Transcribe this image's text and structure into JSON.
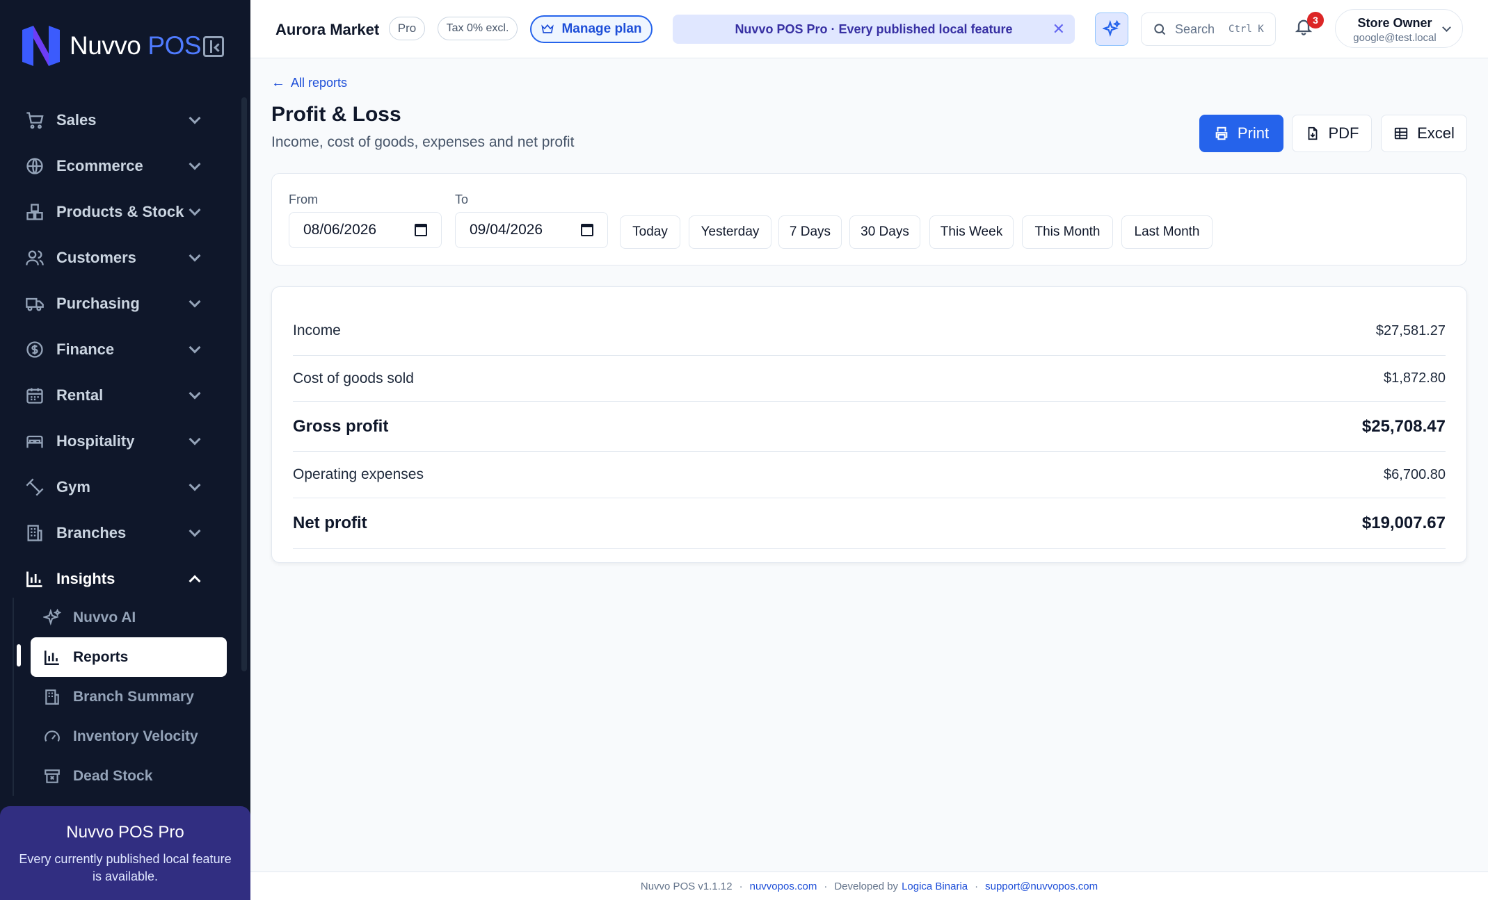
{
  "app": {
    "brand_name": "Nuvvo",
    "brand_suffix": "POS",
    "brand_color": "#4f7bff"
  },
  "sidebar": {
    "nav": [
      {
        "label": "Sales",
        "icon": "cart-icon"
      },
      {
        "label": "Ecommerce",
        "icon": "globe-icon"
      },
      {
        "label": "Products & Stock",
        "icon": "boxes-icon"
      },
      {
        "label": "Customers",
        "icon": "users-icon"
      },
      {
        "label": "Purchasing",
        "icon": "truck-icon"
      },
      {
        "label": "Finance",
        "icon": "dollar-circle-icon"
      },
      {
        "label": "Rental",
        "icon": "calendar-icon"
      },
      {
        "label": "Hospitality",
        "icon": "bed-icon"
      },
      {
        "label": "Gym",
        "icon": "dumbbell-icon"
      },
      {
        "label": "Branches",
        "icon": "building-icon"
      },
      {
        "label": "Insights",
        "icon": "bar-chart-icon",
        "expanded": true
      }
    ],
    "insights_sub": [
      {
        "label": "Nuvvo AI",
        "icon": "sparkles-icon"
      },
      {
        "label": "Reports",
        "icon": "bar-chart-icon",
        "active": true
      },
      {
        "label": "Branch Summary",
        "icon": "building-icon"
      },
      {
        "label": "Inventory Velocity",
        "icon": "gauge-icon"
      },
      {
        "label": "Dead Stock",
        "icon": "archive-x-icon"
      }
    ],
    "promo": {
      "title": "Nuvvo POS Pro",
      "desc": "Every currently published local feature is available."
    }
  },
  "topbar": {
    "store_name": "Aurora Market",
    "plan_pill": "Pro",
    "tax_pill": "Tax 0% excl.",
    "manage_plan": "Manage plan",
    "banner": "Nuvvo POS Pro · Every published local feature",
    "search_label": "Search",
    "search_shortcut": "Ctrl K",
    "notification_count": "3",
    "user_name": "Store Owner",
    "user_email": "google@test.local"
  },
  "page": {
    "back_link": "All reports",
    "title": "Profit & Loss",
    "subtitle": "Income, cost of goods, expenses and net profit",
    "actions": {
      "print": "Print",
      "pdf": "PDF",
      "excel": "Excel"
    },
    "accent": "#2563eb"
  },
  "filters": {
    "from_label": "From",
    "from_value": "08/06/2026",
    "to_label": "To",
    "to_value": "09/04/2026",
    "quick": [
      "Today",
      "Yesterday",
      "7 Days",
      "30 Days",
      "This Week",
      "This Month",
      "Last Month"
    ]
  },
  "report": {
    "rows": [
      {
        "label": "Income",
        "value": "$27,581.27"
      },
      {
        "label": "Cost of goods sold",
        "value": "$1,872.80"
      },
      {
        "label": "Gross profit",
        "value": "$25,708.47",
        "bold": true
      },
      {
        "label": "Operating expenses",
        "value": "$6,700.80"
      },
      {
        "label": "Net profit",
        "value": "$19,007.67",
        "bold": true
      }
    ]
  },
  "footer": {
    "version": "Nuvvo POS v1.1.12",
    "site": "nuvvopos.com",
    "dev_prefix": "Developed by",
    "dev_name": "Logica Binaria",
    "support": "support@nuvvopos.com"
  }
}
